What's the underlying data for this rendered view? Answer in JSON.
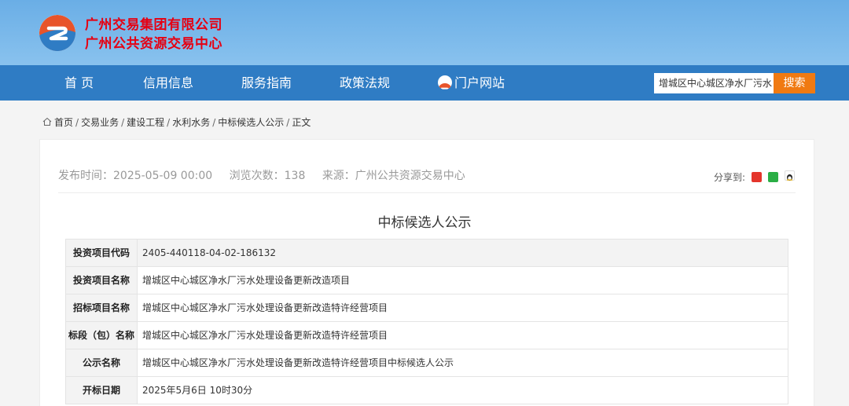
{
  "header": {
    "org_line1": "广州交易集团有限公司",
    "org_line2": "广州公共资源交易中心"
  },
  "nav": {
    "items": [
      "首 页",
      "信用信息",
      "服务指南",
      "政策法规"
    ],
    "portal_label": "门户网站"
  },
  "search": {
    "value": "增城区中心城区净水厂污水",
    "button_label": "搜索"
  },
  "breadcrumb": [
    "首页",
    "交易业务",
    "建设工程",
    "水利水务",
    "中标候选人公示",
    "正文"
  ],
  "article": {
    "publish_time": "发布时间：2025-05-09 00:00",
    "views": "浏览次数：138",
    "source": "来源：广州公共资源交易中心",
    "share_label": "分享到:",
    "title": "中标候选人公示"
  },
  "table": {
    "rows": [
      {
        "key": "投资项目代码",
        "value": "2405-440118-04-02-186132"
      },
      {
        "key": "投资项目名称",
        "value": "增城区中心城区净水厂污水处理设备更新改造项目"
      },
      {
        "key": "招标项目名称",
        "value": "增城区中心城区净水厂污水处理设备更新改造特许经营项目"
      },
      {
        "key": "标段（包）名称",
        "value": "增城区中心城区净水厂污水处理设备更新改造特许经营项目"
      },
      {
        "key": "公示名称",
        "value": "增城区中心城区净水厂污水处理设备更新改造特许经营项目中标候选人公示"
      },
      {
        "key": "开标日期",
        "value": "2025年5月6日 10时30分"
      }
    ]
  },
  "colors": {
    "header_bg": "#7ab8ea",
    "nav_bg": "#2f7cc4",
    "search_button": "#f07a12",
    "brand_red": "#e60012"
  }
}
